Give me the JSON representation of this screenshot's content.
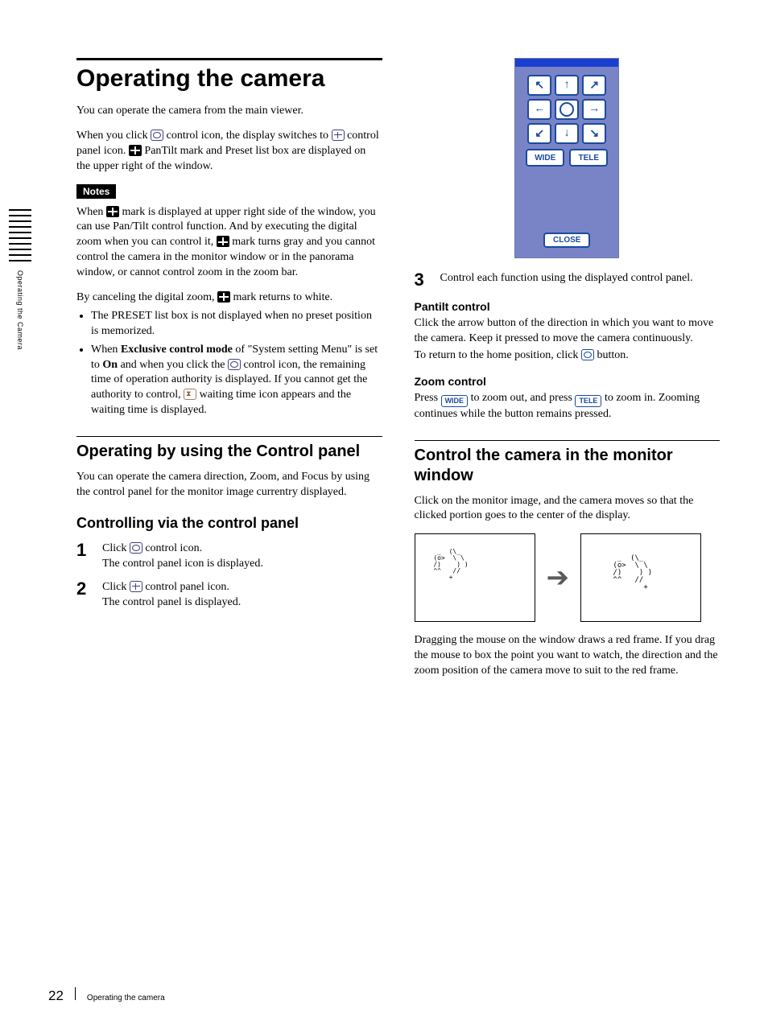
{
  "side_label": "Operating the Camera",
  "title": "Operating the camera",
  "intro": "You can operate the camera from the main viewer.",
  "intro2_a": "When you click ",
  "intro2_b": " control icon, the display switches to ",
  "intro2_c": " control panel icon. ",
  "intro2_d": " PanTilt mark and Preset list box are displayed on the upper right of the window.",
  "notes_label": "Notes",
  "note_p1_a": "When ",
  "note_p1_b": " mark is displayed at upper right side of the window, you can use Pan/Tilt control function. And by executing the digital zoom when you can control it, ",
  "note_p1_c": " mark turns gray and you cannot control the camera in the monitor window or in the panorama window, or cannot control zoom in the zoom bar.",
  "note_p2_a": "By canceling the digital zoom, ",
  "note_p2_b": " mark returns to white.",
  "note_li1": "The PRESET list box is not displayed when no preset position is memorized.",
  "note_li2_a": "When ",
  "note_li2_bold1": "Exclusive control mode",
  "note_li2_b": " of \"System setting Menu\" is set to ",
  "note_li2_bold2": "On",
  "note_li2_c": " and when you click the ",
  "note_li2_d": " control icon, the remaining time of operation authority is displayed. If you cannot get the authority to control, ",
  "note_li2_e": " waiting time icon appears and the waiting time is displayed.",
  "h2_op": "Operating by using the Control panel",
  "op_p": "You can operate the camera direction, Zoom, and Focus by using the control panel for the monitor image currentry displayed.",
  "h3_ctrl": "Controlling via the control panel",
  "steps": {
    "s1": {
      "num": "1",
      "a": "Click ",
      "b": " control icon.",
      "c": "The control panel icon is displayed."
    },
    "s2": {
      "num": "2",
      "a": "Click ",
      "b": " control panel icon.",
      "c": "The control panel is displayed."
    },
    "s3": {
      "num": "3",
      "a": "Control each function using the displayed control panel."
    }
  },
  "panel": {
    "wide": "WIDE",
    "tele": "TELE",
    "close": "CLOSE"
  },
  "h4_pantilt": "Pantilt control",
  "pantilt_p_a": "Click the arrow button of the direction in which you want to move the camera. Keep it pressed to move the camera continuously.",
  "pantilt_p_b_a": "To return to the home position, click ",
  "pantilt_p_b_b": " button.",
  "h4_zoom": "Zoom control",
  "zoom_p_a": "Press ",
  "zoom_p_b": " to zoom out, and press ",
  "zoom_p_c": " to zoom in. Zooming continues while the button remains pressed.",
  "h2_monitor": "Control the camera in the monitor window",
  "monitor_p1": "Click on the monitor image, and the camera moves so that the clicked portion goes to the center of the display.",
  "monitor_p2": "Dragging the mouse on the window draws a red frame. If you drag the mouse to box the point you want to watch, the direction and the zoom position of the camera move to suit to the red frame.",
  "footer": {
    "page": "22",
    "text": "Operating the camera"
  }
}
